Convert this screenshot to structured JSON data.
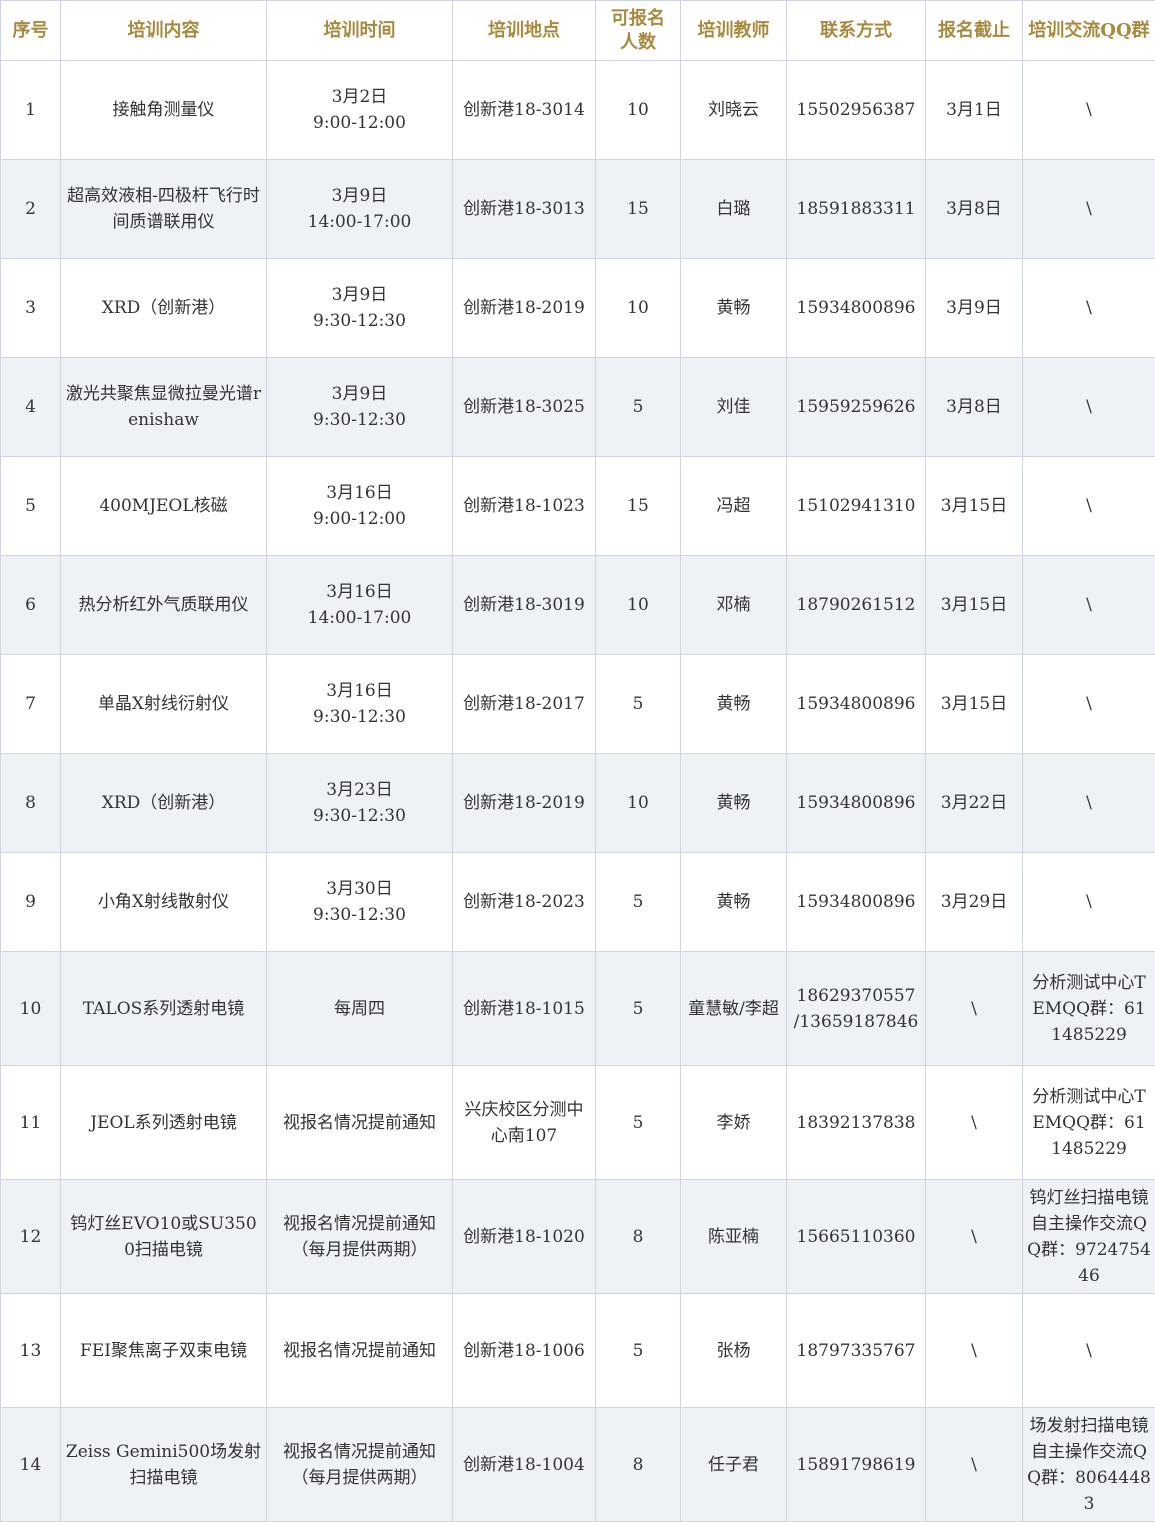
{
  "colors": {
    "header_text": "#a88a3f",
    "border": "#cfd6e0",
    "stripe": "#eef1f5"
  },
  "headers": [
    "序号",
    "培训内容",
    "培训时间",
    "培训地点",
    "可报名人数",
    "培训教师",
    "联系方式",
    "报名截止",
    "培训交流QQ群"
  ],
  "rows": [
    [
      "1",
      "接触角测量仪",
      "3月2日\n9:00-12:00",
      "创新港18-3014",
      "10",
      "刘晓云",
      "15502956387",
      "3月1日",
      "\\"
    ],
    [
      "2",
      "超高效液相-四极杆飞行时间质谱联用仪",
      "3月9日\n14:00-17:00",
      "创新港18-3013",
      "15",
      "白璐",
      "18591883311",
      "3月8日",
      "\\"
    ],
    [
      "3",
      "XRD（创新港）",
      "3月9日\n9:30-12:30",
      "创新港18-2019",
      "10",
      "黄畅",
      "15934800896",
      "3月9日",
      "\\"
    ],
    [
      "4",
      "激光共聚焦显微拉曼光谱renishaw",
      "3月9日\n9:30-12:30",
      "创新港18-3025",
      "5",
      "刘佳",
      "15959259626",
      "3月8日",
      "\\"
    ],
    [
      "5",
      "400MJEOL核磁",
      "3月16日\n9:00-12:00",
      "创新港18-1023",
      "15",
      "冯超",
      "15102941310",
      "3月15日",
      "\\"
    ],
    [
      "6",
      "热分析红外气质联用仪",
      "3月16日\n14:00-17:00",
      "创新港18-3019",
      "10",
      "邓楠",
      "18790261512",
      "3月15日",
      "\\"
    ],
    [
      "7",
      "单晶X射线衍射仪",
      "3月16日\n9:30-12:30",
      "创新港18-2017",
      "5",
      "黄畅",
      "15934800896",
      "3月15日",
      "\\"
    ],
    [
      "8",
      "XRD（创新港）",
      "3月23日\n9:30-12:30",
      "创新港18-2019",
      "10",
      "黄畅",
      "15934800896",
      "3月22日",
      "\\"
    ],
    [
      "9",
      "小角X射线散射仪",
      "3月30日\n9:30-12:30",
      "创新港18-2023",
      "5",
      "黄畅",
      "15934800896",
      "3月29日",
      "\\"
    ],
    [
      "10",
      "TALOS系列透射电镜",
      "每周四",
      "创新港18-1015",
      "5",
      "童慧敏/李超",
      "18629370557\n/13659187846",
      "\\",
      "分析测试中心TEMQQ群：611485229"
    ],
    [
      "11",
      "JEOL系列透射电镜",
      "视报名情况提前通知",
      "兴庆校区分测中心南107",
      "5",
      "李娇",
      "18392137838",
      "\\",
      "分析测试中心TEMQQ群：611485229"
    ],
    [
      "12",
      "钨灯丝EVO10或SU3500扫描电镜",
      "视报名情况提前通知\n（每月提供两期）",
      "创新港18-1020",
      "8",
      "陈亚楠",
      "15665110360",
      "\\",
      "钨灯丝扫描电镜自主操作交流QQ群：972475446"
    ],
    [
      "13",
      "FEI聚焦离子双束电镜",
      "视报名情况提前通知",
      "创新港18-1006",
      "5",
      "张杨",
      "18797335767",
      "\\",
      "\\"
    ],
    [
      "14",
      "Zeiss Gemini500场发射扫描电镜",
      "视报名情况提前通知\n（每月提供两期）",
      "创新港18-1004",
      "8",
      "任子君",
      "15891798619",
      "\\",
      "场发射扫描电镜自主操作交流QQ群：80644483"
    ]
  ]
}
